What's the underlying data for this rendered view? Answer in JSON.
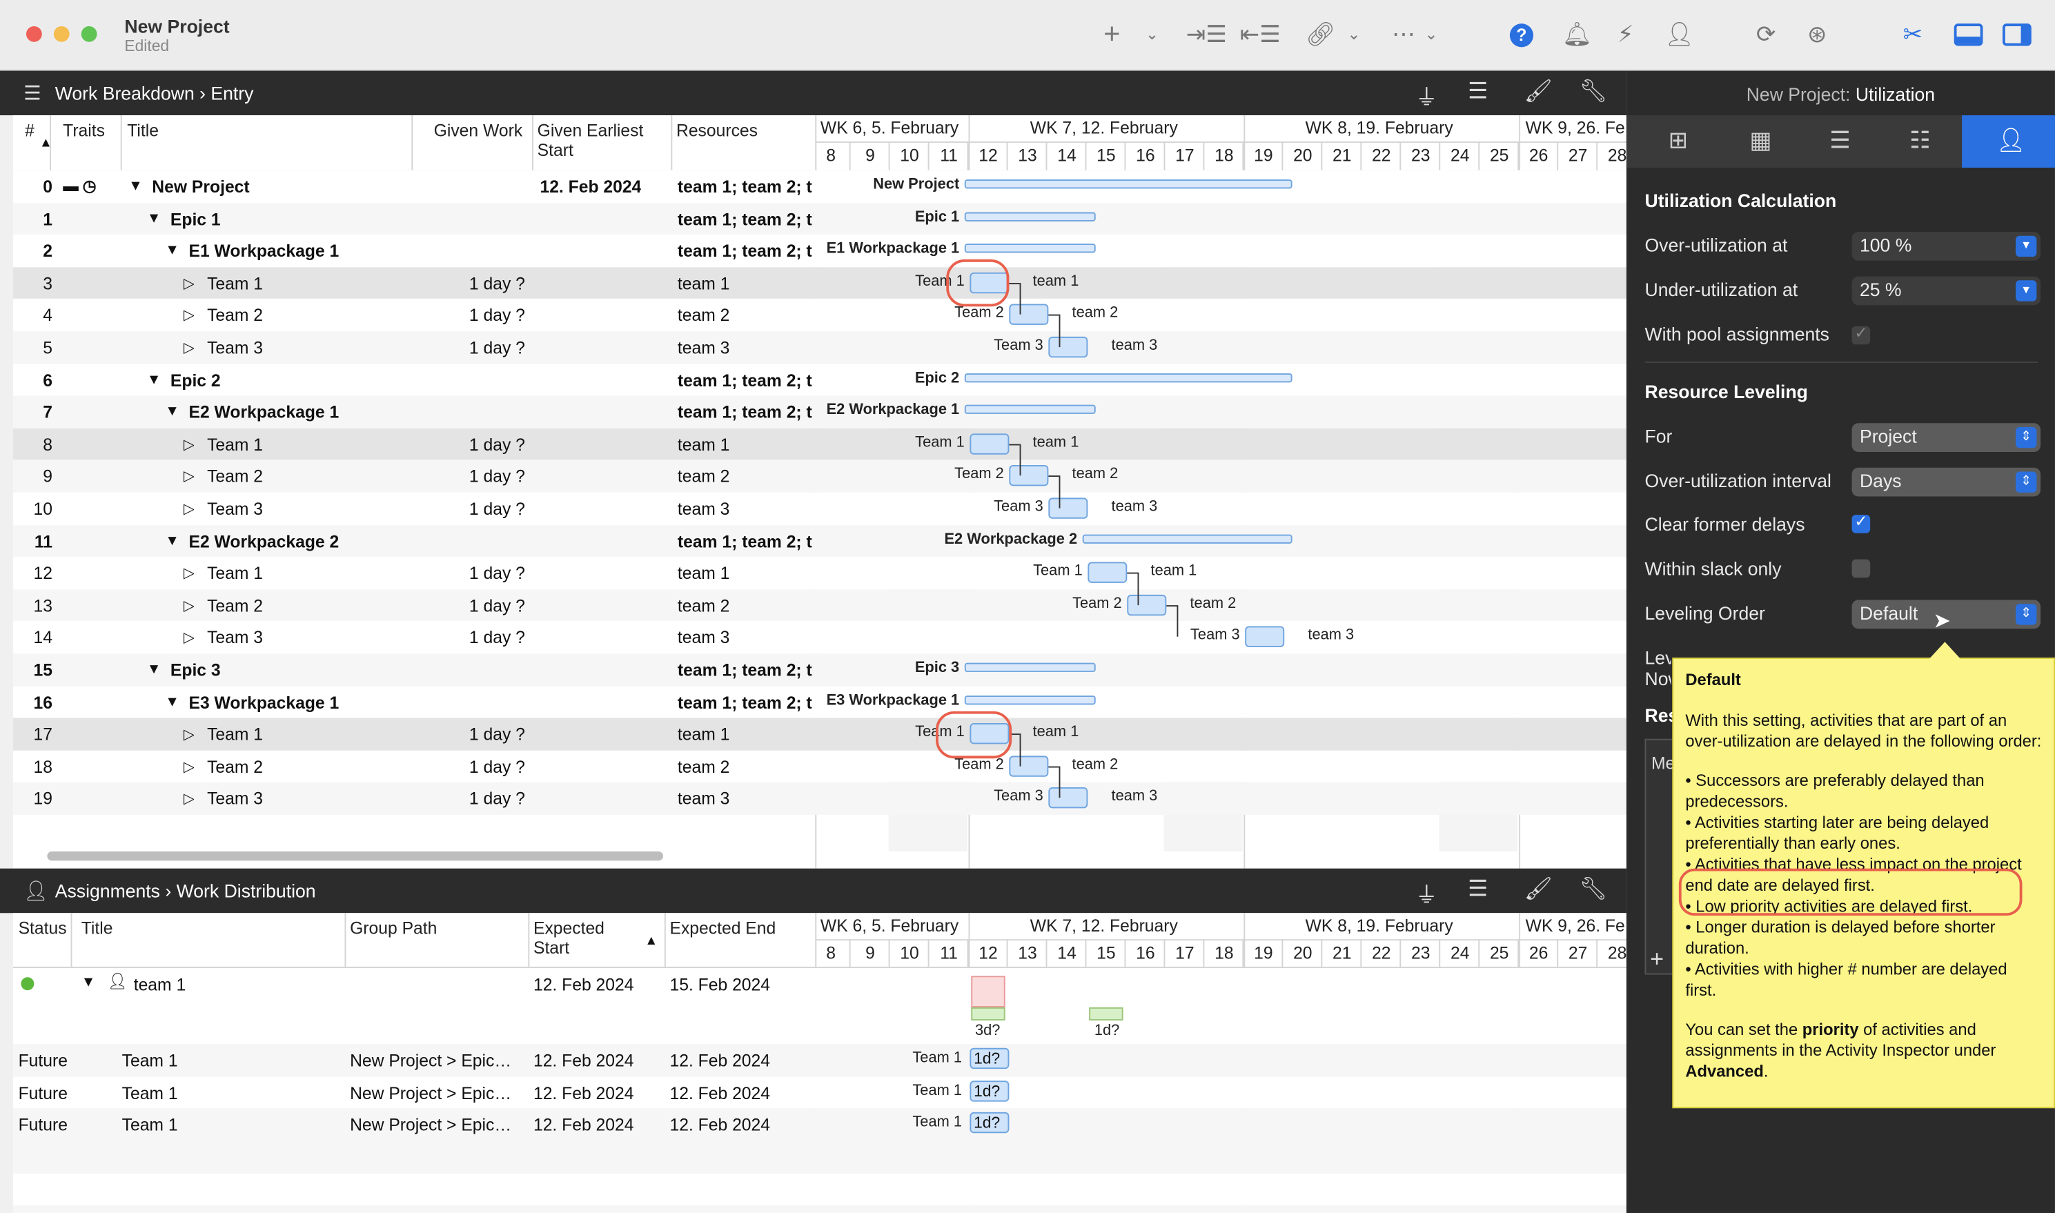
{
  "window": {
    "title": "New Project",
    "subtitle": "Edited"
  },
  "toolbar": {
    "icons": [
      "plus-icon",
      "chevron-down-icon",
      "indent-icon",
      "outdent-icon",
      "link-icon",
      "chevron-down-icon",
      "more-icon",
      "chevron-down-icon",
      "help-icon",
      "bell-icon",
      "flash-icon",
      "person-icon",
      "refresh-icon",
      "compass-icon",
      "tools-icon",
      "bottom-panel-icon",
      "right-panel-icon"
    ],
    "help_label": "?"
  },
  "top_panel": {
    "breadcrumb": [
      "Work Breakdown",
      "Entry"
    ],
    "columns": {
      "num": "#",
      "traits": "Traits",
      "title": "Title",
      "given_work": "Given Work",
      "earliest_start": "Given Earliest Start",
      "resources": "Resources"
    },
    "weeks": [
      "WK 6, 5. February",
      "WK 7, 12. February",
      "WK 8, 19. February",
      "WK 9, 26. Fe"
    ],
    "days": [
      "8",
      "9",
      "10",
      "11",
      "12",
      "13",
      "14",
      "15",
      "16",
      "17",
      "18",
      "19",
      "20",
      "21",
      "22",
      "23",
      "24",
      "25",
      "26",
      "27",
      "28"
    ],
    "rows": [
      {
        "num": "0",
        "title": "New Project",
        "work": "",
        "start": "12. Feb 2024",
        "res": "team 1; team 2; t",
        "gl": "New Project",
        "gr": "",
        "level": 0,
        "sum": true
      },
      {
        "num": "1",
        "title": "Epic 1",
        "work": "",
        "start": "",
        "res": "team 1; team 2; t",
        "gl": "Epic 1",
        "gr": "",
        "level": 1,
        "sum": true
      },
      {
        "num": "2",
        "title": "E1 Workpackage 1",
        "work": "",
        "start": "",
        "res": "team 1; team 2; t",
        "gl": "E1 Workpackage 1",
        "gr": "",
        "level": 2,
        "sum": true
      },
      {
        "num": "3",
        "title": "Team 1",
        "work": "1 day ?",
        "start": "",
        "res": "team 1",
        "gl": "Team 1",
        "gr": "team 1",
        "level": 3,
        "sum": false
      },
      {
        "num": "4",
        "title": "Team 2",
        "work": "1 day ?",
        "start": "",
        "res": "team 2",
        "gl": "Team 2",
        "gr": "team 2",
        "level": 3,
        "sum": false
      },
      {
        "num": "5",
        "title": "Team 3",
        "work": "1 day ?",
        "start": "",
        "res": "team 3",
        "gl": "Team 3",
        "gr": "team 3",
        "level": 3,
        "sum": false
      },
      {
        "num": "6",
        "title": "Epic 2",
        "work": "",
        "start": "",
        "res": "team 1; team 2; t",
        "gl": "Epic 2",
        "gr": "",
        "level": 1,
        "sum": true
      },
      {
        "num": "7",
        "title": "E2 Workpackage 1",
        "work": "",
        "start": "",
        "res": "team 1; team 2; t",
        "gl": "E2 Workpackage 1",
        "gr": "",
        "level": 2,
        "sum": true
      },
      {
        "num": "8",
        "title": "Team 1",
        "work": "1 day ?",
        "start": "",
        "res": "team 1",
        "gl": "Team 1",
        "gr": "team 1",
        "level": 3,
        "sum": false
      },
      {
        "num": "9",
        "title": "Team 2",
        "work": "1 day ?",
        "start": "",
        "res": "team 2",
        "gl": "Team 2",
        "gr": "team 2",
        "level": 3,
        "sum": false
      },
      {
        "num": "10",
        "title": "Team 3",
        "work": "1 day ?",
        "start": "",
        "res": "team 3",
        "gl": "Team 3",
        "gr": "team 3",
        "level": 3,
        "sum": false
      },
      {
        "num": "11",
        "title": "E2 Workpackage 2",
        "work": "",
        "start": "",
        "res": "team 1; team 2; t",
        "gl": "E2 Workpackage 2",
        "gr": "",
        "level": 2,
        "sum": true
      },
      {
        "num": "12",
        "title": "Team 1",
        "work": "1 day ?",
        "start": "",
        "res": "team 1",
        "gl": "Team 1",
        "gr": "team 1",
        "level": 3,
        "sum": false
      },
      {
        "num": "13",
        "title": "Team 2",
        "work": "1 day ?",
        "start": "",
        "res": "team 2",
        "gl": "Team 2",
        "gr": "team 2",
        "level": 3,
        "sum": false
      },
      {
        "num": "14",
        "title": "Team 3",
        "work": "1 day ?",
        "start": "",
        "res": "team 3",
        "gl": "Team 3",
        "gr": "team 3",
        "level": 3,
        "sum": false
      },
      {
        "num": "15",
        "title": "Epic 3",
        "work": "",
        "start": "",
        "res": "team 1; team 2; t",
        "gl": "Epic 3",
        "gr": "",
        "level": 1,
        "sum": true
      },
      {
        "num": "16",
        "title": "E3 Workpackage 1",
        "work": "",
        "start": "",
        "res": "team 1; team 2; t",
        "gl": "E3 Workpackage 1",
        "gr": "",
        "level": 2,
        "sum": true
      },
      {
        "num": "17",
        "title": "Team 1",
        "work": "1 day ?",
        "start": "",
        "res": "team 1",
        "gl": "Team 1",
        "gr": "team 1",
        "level": 3,
        "sum": false
      },
      {
        "num": "18",
        "title": "Team 2",
        "work": "1 day ?",
        "start": "",
        "res": "team 2",
        "gl": "Team 2",
        "gr": "team 2",
        "level": 3,
        "sum": false
      },
      {
        "num": "19",
        "title": "Team 3",
        "work": "1 day ?",
        "start": "",
        "res": "team 3",
        "gl": "Team 3",
        "gr": "team 3",
        "level": 3,
        "sum": false
      }
    ]
  },
  "bottom_panel": {
    "breadcrumb": [
      "Assignments",
      "Work Distribution"
    ],
    "columns": {
      "status": "Status",
      "title": "Title",
      "group_path": "Group Path",
      "expected_start": "Expected Start",
      "expected_end": "Expected End"
    },
    "group": {
      "title": "team 1",
      "start": "12. Feb 2024",
      "end": "15. Feb 2024",
      "hist_a": "3d?",
      "hist_b": "1d?"
    },
    "rows": [
      {
        "status": "Future",
        "title": "Team 1",
        "path": "New Project > Epic…",
        "start": "12. Feb 2024",
        "end": "12. Feb 2024",
        "gl": "Team 1",
        "bar": "1d?"
      },
      {
        "status": "Future",
        "title": "Team 1",
        "path": "New Project > Epic…",
        "start": "12. Feb 2024",
        "end": "12. Feb 2024",
        "gl": "Team 1",
        "bar": "1d?"
      },
      {
        "status": "Future",
        "title": "Team 1",
        "path": "New Project > Epic…",
        "start": "12. Feb 2024",
        "end": "12. Feb 2024",
        "gl": "Team 1",
        "bar": "1d?"
      }
    ]
  },
  "inspector": {
    "header_prefix": "New Project: ",
    "header_name": "Utilization",
    "tabs": [
      "sliders-icon",
      "calendar-icon",
      "list-icon",
      "checklist-icon",
      "resource-icon"
    ],
    "util_title": "Utilization Calculation",
    "over_label": "Over-utilization at",
    "over_value": "100 %",
    "under_label": "Under-utilization at",
    "under_value": "25 %",
    "pool_label": "With pool assignments",
    "pool_checked": true,
    "level_title": "Resource Leveling",
    "for_label": "For",
    "for_value": "Project",
    "interval_label": "Over-utilization interval",
    "interval_value": "Days",
    "clear_label": "Clear former delays",
    "clear_checked": true,
    "slack_label": "Within slack only",
    "slack_checked": false,
    "order_label": "Leveling Order",
    "order_value": "Default",
    "level_now_partial": "Level Now",
    "res_partial": "Res",
    "me_partial": "Me"
  },
  "tooltip": {
    "title": "Default",
    "intro": "With this setting, activities that are part of an over-utilization are delayed in the following order:",
    "bullets": [
      "• Successors are preferably delayed than predecessors.",
      "• Activities starting later are being delayed preferentially than early ones.",
      "• Activities that have less impact on the project end date are delayed first.",
      "• Low priority activities are delayed first.",
      "• Longer duration is delayed before shorter duration.",
      "• Activities with higher # number are delayed first."
    ],
    "outro_1": "You can set the ",
    "outro_bold_1": "priority",
    "outro_2": " of activities and assignments in the Activity Inspector under ",
    "outro_bold_2": "Advanced",
    "outro_3": "."
  },
  "colors": {
    "accent": "#2a70e0",
    "highlight": "#e8604c",
    "tooltip_bg": "#fbf58a",
    "bar": "#cfe3fa"
  }
}
